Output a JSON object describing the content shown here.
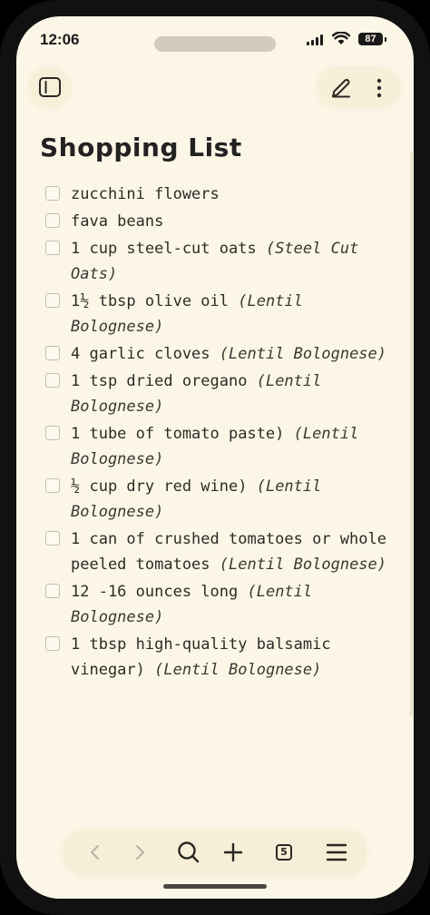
{
  "status": {
    "time": "12:06",
    "battery": "87"
  },
  "page": {
    "title": "Shopping List"
  },
  "items": [
    {
      "text": "zucchini flowers",
      "recipe": ""
    },
    {
      "text": "fava beans",
      "recipe": ""
    },
    {
      "text": "1 cup steel-cut oats",
      "recipe": "(Steel Cut Oats)"
    },
    {
      "text": "1½ tbsp olive oil",
      "recipe": "(Lentil Bolognese)"
    },
    {
      "text": "4 garlic cloves",
      "recipe": "(Lentil Bolognese)"
    },
    {
      "text": "1 tsp dried oregano",
      "recipe": "(Lentil Bolognese)"
    },
    {
      "text": "1 tube of tomato paste)",
      "recipe": "(Lentil Bolognese)"
    },
    {
      "text": "½ cup dry red wine)",
      "recipe": "(Lentil Bolognese)"
    },
    {
      "text": "1 can of crushed tomatoes or whole peeled tomatoes",
      "recipe": "(Lentil Bolognese)"
    },
    {
      "text": "12 -16 ounces long",
      "recipe": "(Lentil Bolognese)"
    },
    {
      "text": "1 tbsp high-quality balsamic vinegar)",
      "recipe": "(Lentil Bolognese)"
    }
  ],
  "toolbar": {
    "tab_count": "5"
  },
  "icons": {
    "sidebar": "sidebar-icon",
    "edit": "pencil-icon",
    "more": "more-vertical-icon",
    "back": "chevron-left-icon",
    "forward": "chevron-right-icon",
    "search": "search-icon",
    "add": "plus-icon",
    "tabs": "tabs-icon",
    "menu": "menu-icon"
  },
  "colors": {
    "background": "#fcf6e6",
    "text": "#2a2824",
    "checkbox_border": "#c4beb2"
  }
}
